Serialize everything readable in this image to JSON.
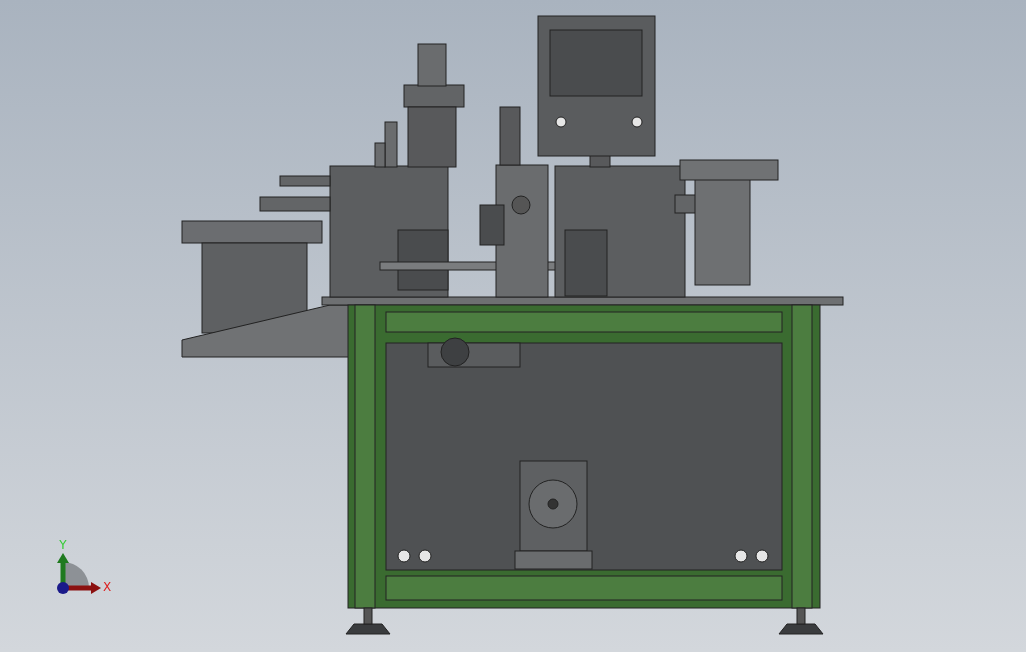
{
  "viewport": {
    "triad": {
      "axes": [
        {
          "kind": "y",
          "label": "Y",
          "color": "#1f7a1f"
        },
        {
          "kind": "x",
          "label": "X",
          "color": "#8b1010"
        }
      ]
    }
  }
}
